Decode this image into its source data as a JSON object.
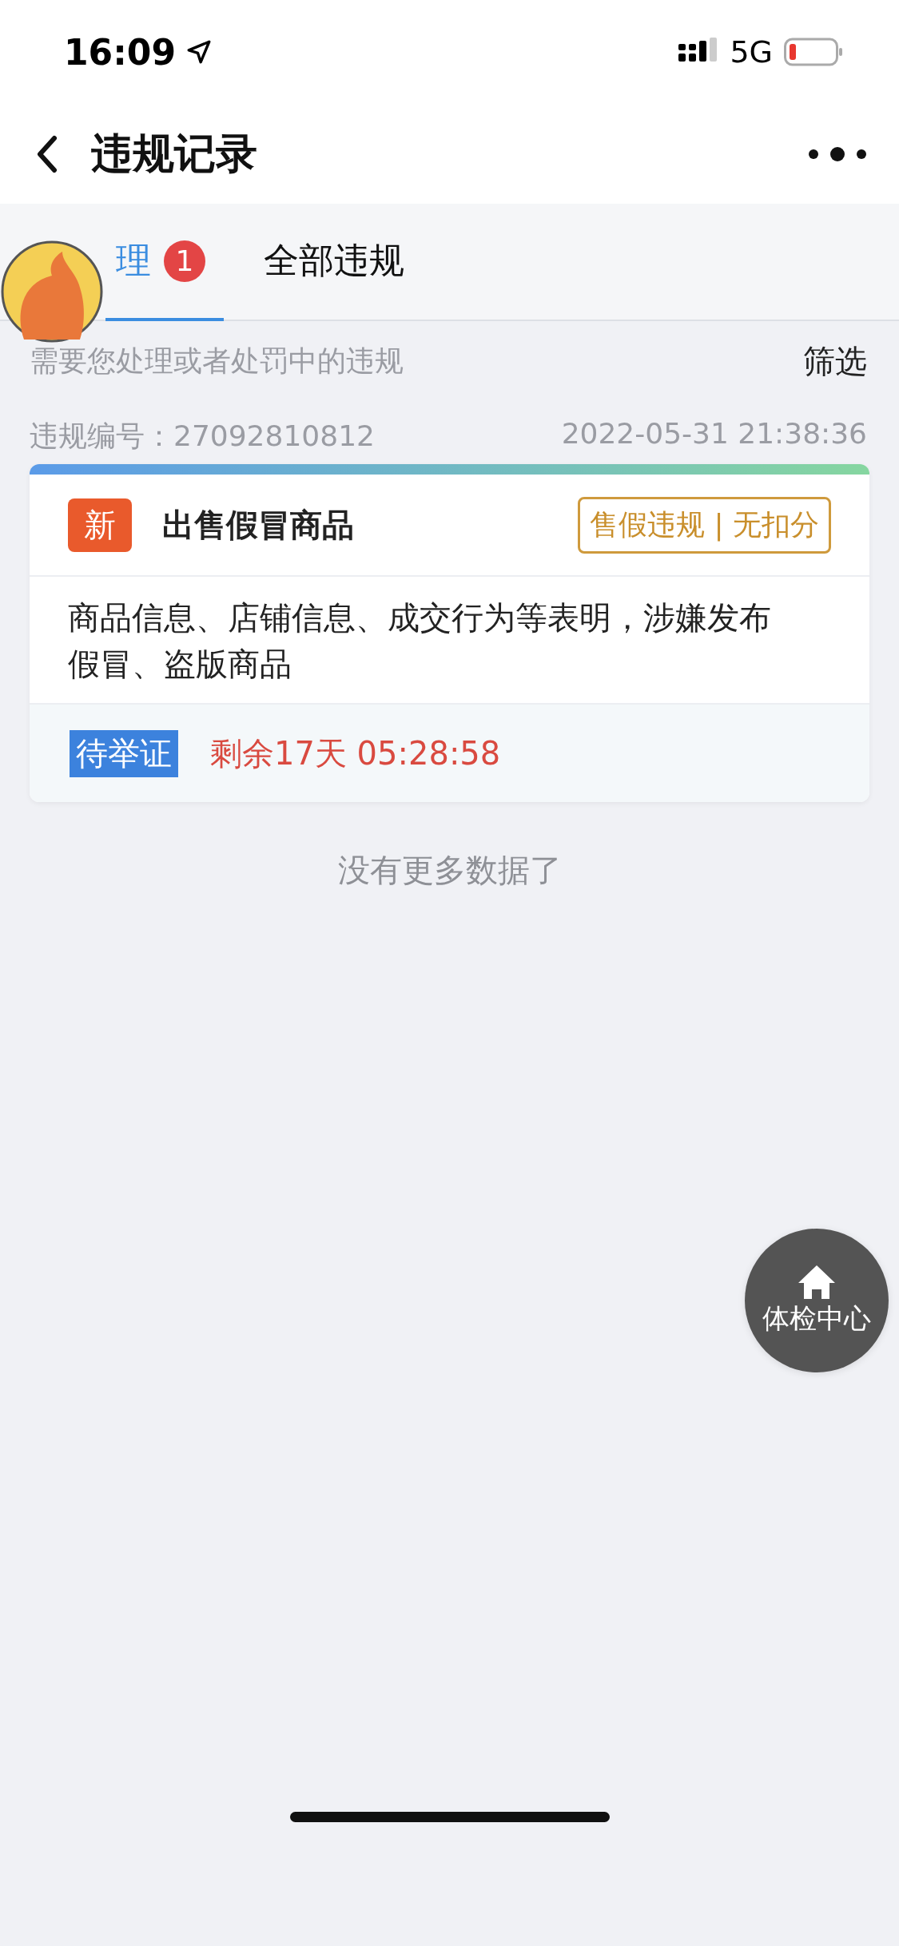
{
  "status_bar": {
    "time": "16:09",
    "network": "5G"
  },
  "nav": {
    "title": "违规记录"
  },
  "tabs": [
    {
      "label": "理",
      "selected": true,
      "badge": "1"
    },
    {
      "label": "全部违规",
      "selected": false
    }
  ],
  "hint": "需要您处理或者处罚中的违规",
  "filter": "筛选",
  "records": [
    {
      "number": "违规编号：27092810812",
      "time": "2022-05-31 21:38:36",
      "tag": "新",
      "title": "出售假冒商品",
      "category": "售假违规 | 无扣分",
      "description": "商品信息、店铺信息、成交行为等表明，涉嫌发布假冒、盗版商品",
      "status": "待举证",
      "countdown": "剩余17天 05:28:58"
    }
  ],
  "end_text": "没有更多数据了",
  "float_button": {
    "label": "体检中心"
  }
}
